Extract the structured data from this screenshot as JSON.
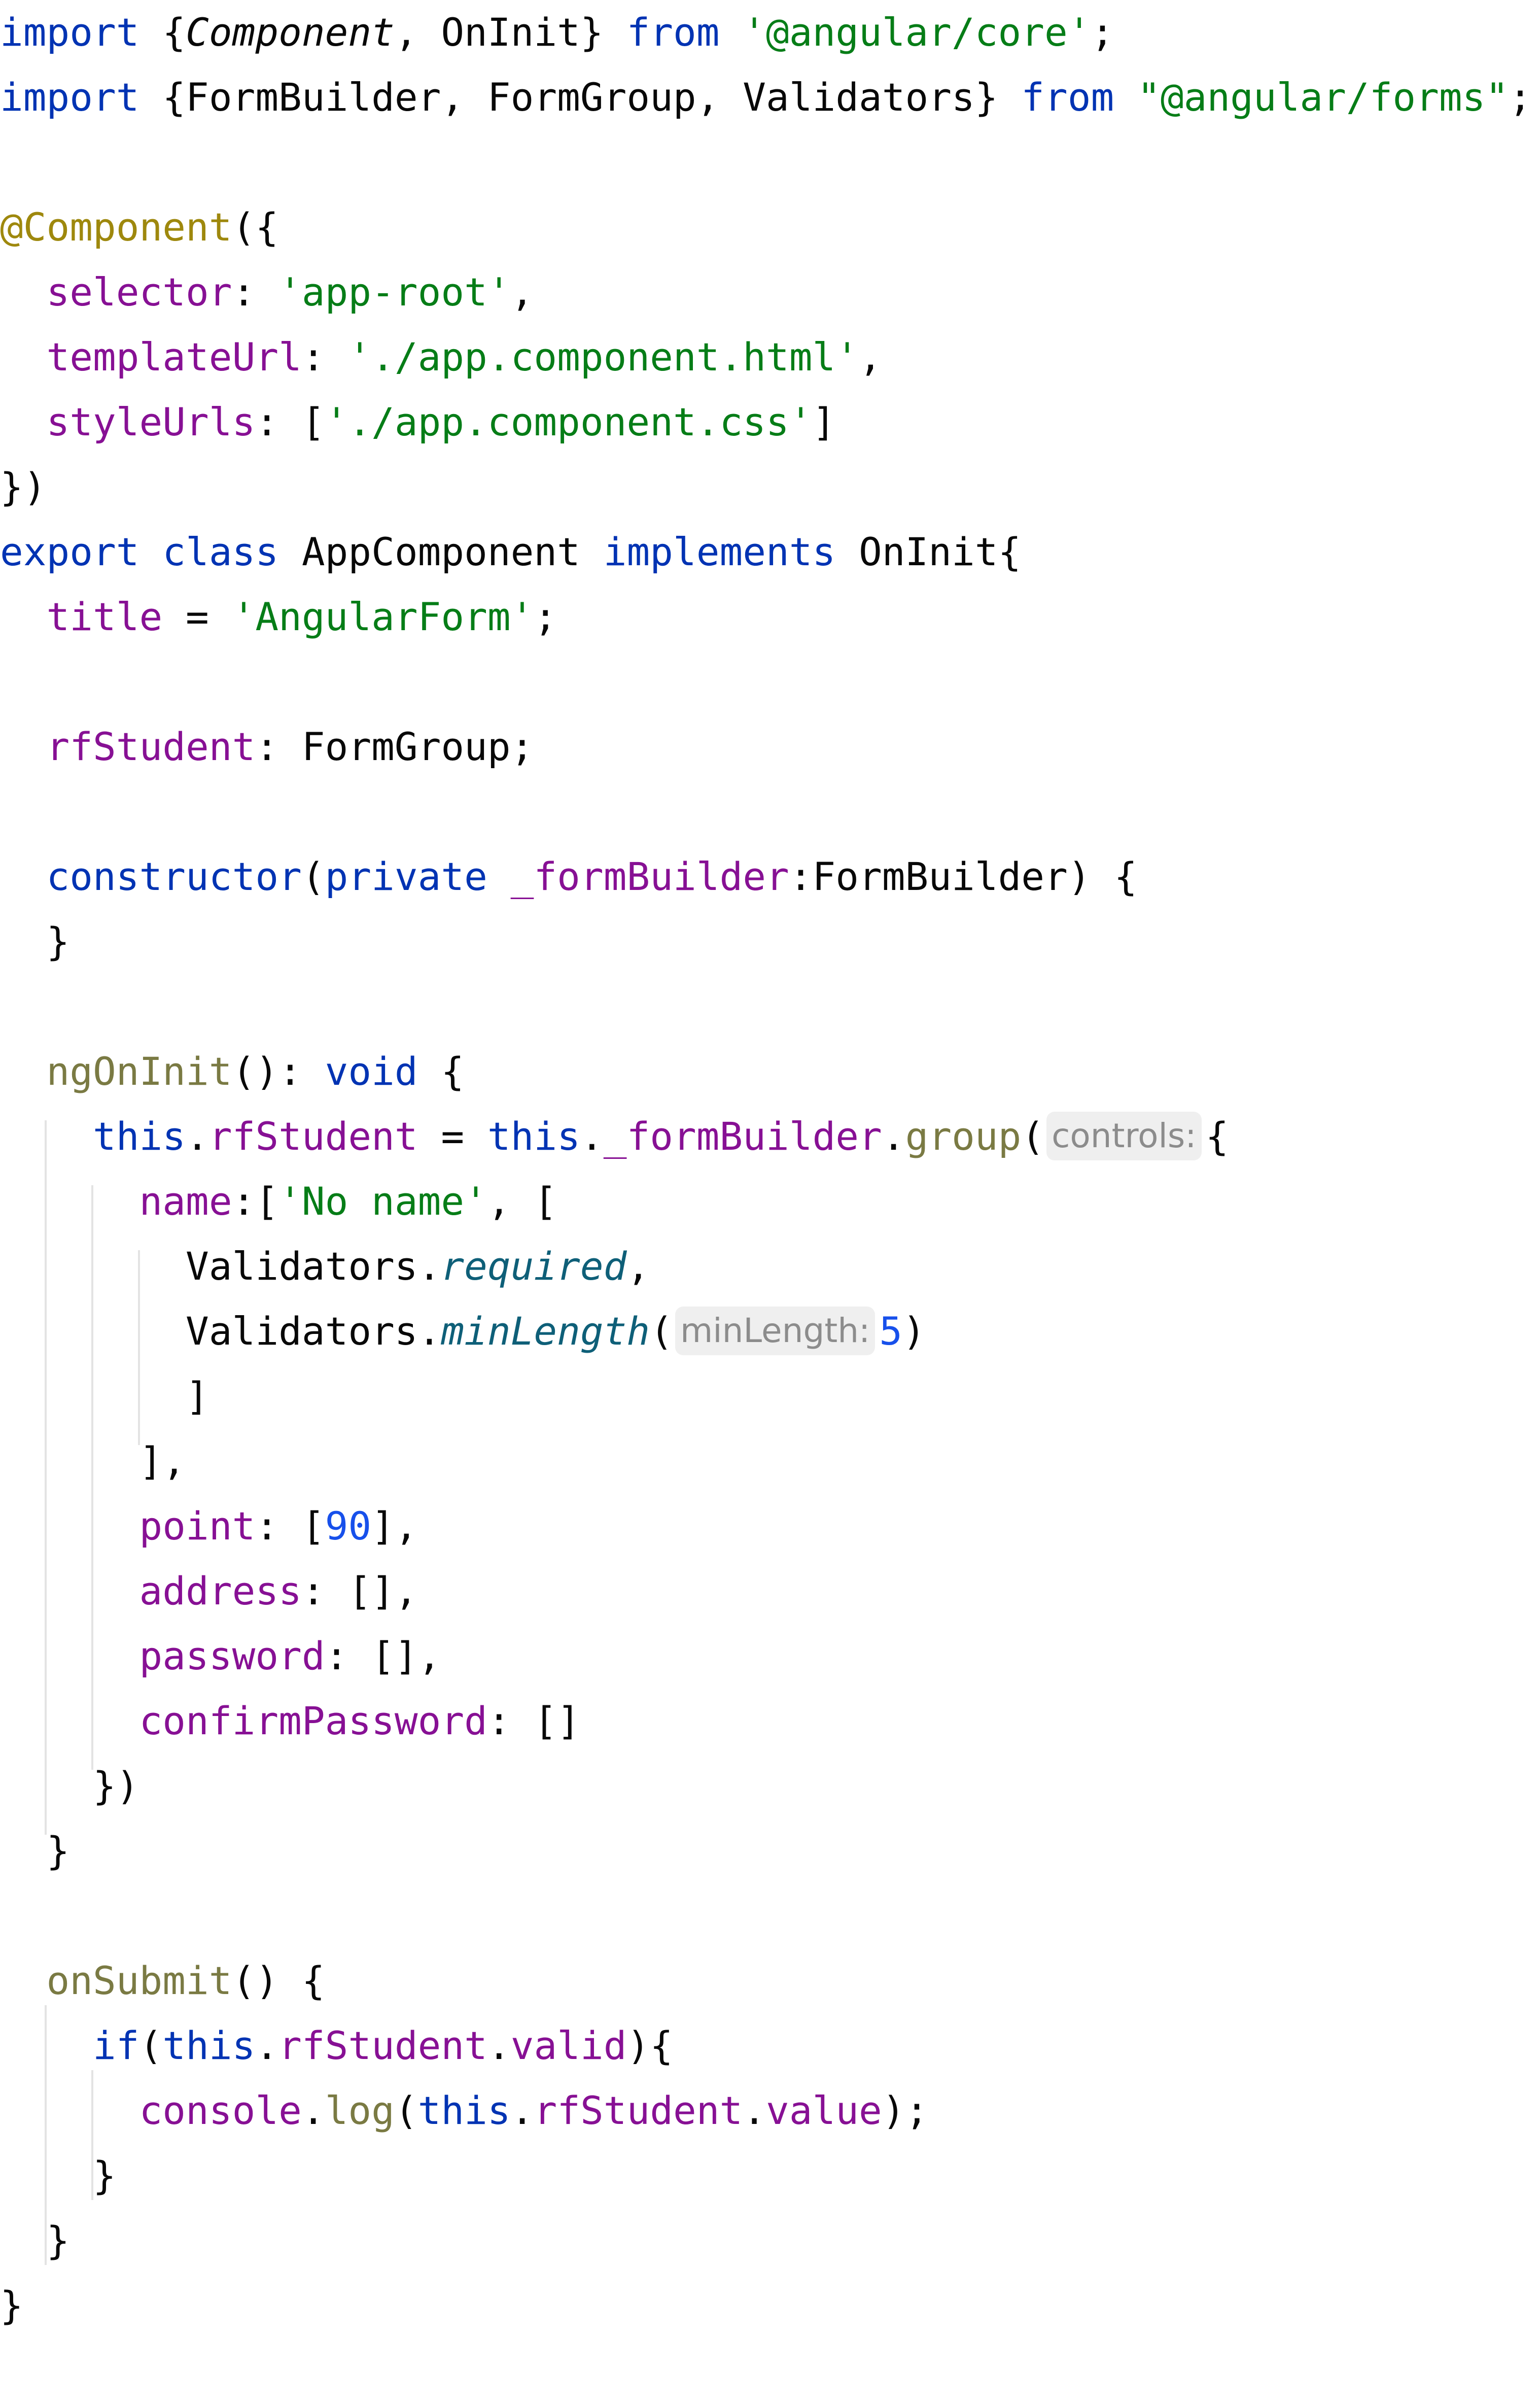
{
  "editor": {
    "hint_controls": "controls:",
    "hint_minlength": "minLength:",
    "lines": {
      "l1": [
        "import",
        " {",
        "Component",
        ", OnInit} ",
        "from",
        " ",
        "'@angular/core'",
        ";"
      ],
      "l2": [
        "import",
        " {FormBuilder, FormGroup, Validators} ",
        "from",
        " ",
        "\"@angular/forms\"",
        ";"
      ],
      "l4": [
        "@Component",
        "({"
      ],
      "l5": [
        "  ",
        "selector",
        ": ",
        "'app-root'",
        ","
      ],
      "l6": [
        "  ",
        "templateUrl",
        ": ",
        "'./app.component.html'",
        ","
      ],
      "l7": [
        "  ",
        "styleUrls",
        ": [",
        "'./app.component.css'",
        "]"
      ],
      "l8": [
        "})"
      ],
      "l9": [
        "export",
        " ",
        "class",
        " AppComponent ",
        "implements",
        " OnInit{"
      ],
      "l10": [
        "  ",
        "title",
        " = ",
        "'AngularForm'",
        ";"
      ],
      "l12": [
        "  ",
        "rfStudent",
        ": FormGroup;"
      ],
      "l14": [
        "  ",
        "constructor",
        "(",
        "private",
        " ",
        "_formBuilder",
        ":FormBuilder) {"
      ],
      "l15": [
        "  }"
      ],
      "l17": [
        "  ",
        "ngOnInit",
        "(): ",
        "void",
        " {"
      ],
      "l18": [
        "    ",
        "this",
        ".",
        "rfStudent",
        " = ",
        "this",
        ".",
        "_formBuilder",
        ".",
        "group",
        "(",
        "{"
      ],
      "l19": [
        "      ",
        "name",
        ":[",
        "'No name'",
        ", ["
      ],
      "l20": [
        "        Validators.",
        "required",
        ","
      ],
      "l21": [
        "        Validators.",
        "minLength",
        "(",
        "5",
        ")"
      ],
      "l22": [
        "        ]"
      ],
      "l23": [
        "      ],"
      ],
      "l24": [
        "      ",
        "point",
        ": [",
        "90",
        "],"
      ],
      "l25": [
        "      ",
        "address",
        ": [],"
      ],
      "l26": [
        "      ",
        "password",
        ": [],"
      ],
      "l27": [
        "      ",
        "confirmPassword",
        ": []"
      ],
      "l28": [
        "    })"
      ],
      "l29": [
        "  }"
      ],
      "l31": [
        "  ",
        "onSubmit",
        "() {"
      ],
      "l32": [
        "    ",
        "if",
        "(",
        "this",
        ".",
        "rfStudent",
        ".",
        "valid",
        "){"
      ],
      "l33": [
        "      ",
        "console",
        ".",
        "log",
        "(",
        "this",
        ".",
        "rfStudent",
        ".",
        "value",
        ");"
      ],
      "l34": [
        "    }"
      ],
      "l35": [
        "  }"
      ],
      "l36": [
        "}"
      ]
    }
  },
  "colors": {
    "keyword": "#0033b3",
    "string": "#067d17",
    "property": "#871094",
    "function": "#7a7a43",
    "decorator": "#9e880d",
    "number": "#1750eb",
    "static-member": "#0e5f78",
    "text": "#080808",
    "hint-text": "#8c8c8c",
    "hint-bg": "#efefef",
    "background": "#ffffff"
  }
}
